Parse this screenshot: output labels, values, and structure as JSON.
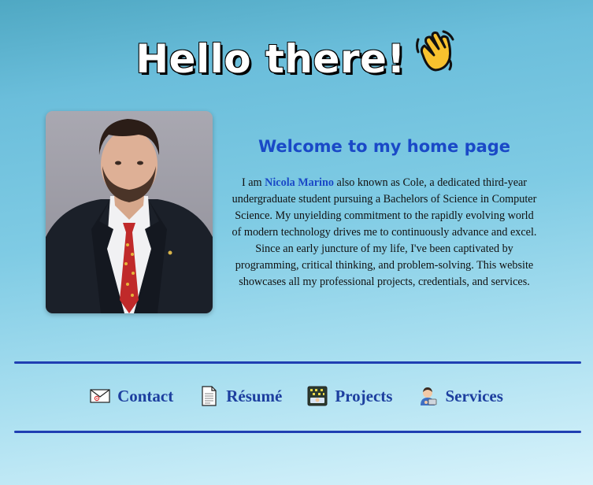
{
  "hero": {
    "title": "Hello there!",
    "icon": "waving-hand-icon"
  },
  "profile": {
    "photo_alt": "Portrait of Nicola Marino",
    "heading": "Welcome to my home page",
    "bio_prefix": "I am ",
    "name": "Nicola Marino",
    "bio_suffix": " also known as Cole, a dedicated third-year undergraduate student pursuing a Bachelors of Science in Computer Science. My unyielding commitment to the rapidly evolving world of modern technology drives me to continuously advance and excel. Since an early juncture of my life, I've been captivated by programming, critical thinking, and problem-solving. This website showcases all my professional projects, credentials, and services."
  },
  "nav": {
    "items": [
      {
        "label": "Contact",
        "icon": "envelope-icon"
      },
      {
        "label": "Résumé",
        "icon": "document-icon"
      },
      {
        "label": "Projects",
        "icon": "computer-screen-icon"
      },
      {
        "label": "Services",
        "icon": "technologist-icon"
      }
    ]
  },
  "colors": {
    "accent": "#1a49c7",
    "nav_text": "#1d3f9f",
    "divider": "#1f3fb2",
    "bg_top": "#4fa8c3",
    "bg_bottom": "#d9f3fb"
  }
}
